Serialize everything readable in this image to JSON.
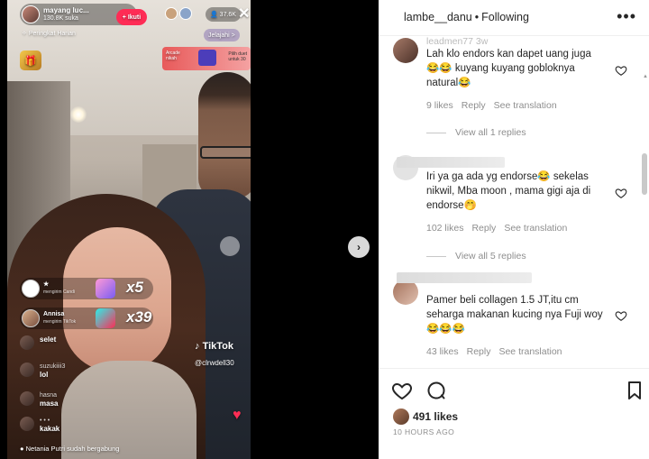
{
  "video": {
    "streamer_name": "mayang luc...",
    "streamer_likes": "130.8K suka",
    "follow_label": "+ Ikuti",
    "viewer_count": "37.6K",
    "close_label": "✕",
    "rank_label": "Peringkat Harian",
    "explore_label": "Jelajahi >",
    "promo_left": "Arcade\nnikah",
    "promo_right": "Pilih duet\nuntuk 30",
    "gifts": [
      {
        "name": "",
        "sub": "mengirim Candi",
        "count": "x5"
      },
      {
        "name": "Annisa",
        "sub": "mengirim TikTok",
        "count": "x39"
      }
    ],
    "chat": [
      {
        "name": "",
        "msg": "selet"
      },
      {
        "name": "suzukiiii3",
        "msg": "lol"
      },
      {
        "name": "hasna",
        "msg": "masa"
      },
      {
        "name": "• • •",
        "msg": "kakak"
      }
    ],
    "joined_text": "Netania Putri sudah bergabung",
    "tiktok_logo": "TikTok",
    "tiktok_user": "@clrwdell30"
  },
  "nav": {
    "next_arrow": "›"
  },
  "post": {
    "username": "lambe__danu",
    "follow_status": "Following",
    "more_label": "•••",
    "comments": [
      {
        "user": "leadmen77  3w",
        "text": "Lah klo endors kan dapet uang juga 😂😂 kuyang kuyang gobloknya natural😂",
        "likes": "9 likes",
        "reply": "Reply",
        "translate": "See translation",
        "view_replies": "View all 1 replies"
      },
      {
        "user": "",
        "text": "Iri ya ga ada yg endorse😂 sekelas nikwil, Mba moon , mama gigi aja di endorse🤭",
        "likes": "102 likes",
        "reply": "Reply",
        "translate": "See translation",
        "view_replies": "View all 5 replies"
      },
      {
        "user": "",
        "text": "Pamer beli collagen 1.5 JT,itu cm seharga makanan kucing nya Fuji woy😂😂😂",
        "likes": "43 likes",
        "reply": "Reply",
        "translate": "See translation"
      }
    ],
    "likes_total": "491 likes",
    "time_ago": "10 HOURS AGO"
  }
}
